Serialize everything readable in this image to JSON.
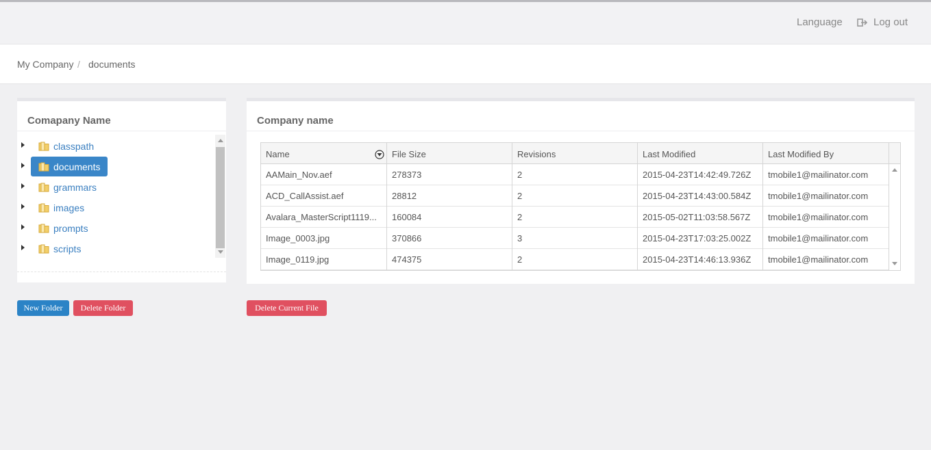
{
  "nav": {
    "language_label": "Language",
    "logout_label": "Log out"
  },
  "breadcrumb": {
    "home": "My Company",
    "separator": "/",
    "current": "documents"
  },
  "left_panel": {
    "title": "Comapany Name",
    "folders": [
      {
        "label": "classpath",
        "selected": false
      },
      {
        "label": "documents",
        "selected": true
      },
      {
        "label": "grammars",
        "selected": false
      },
      {
        "label": "images",
        "selected": false
      },
      {
        "label": "prompts",
        "selected": false
      },
      {
        "label": "scripts",
        "selected": false
      }
    ]
  },
  "right_panel": {
    "title": "Company name",
    "columns": [
      "Name",
      "File Size",
      "Revisions",
      "Last Modified",
      "Last Modified By"
    ],
    "rows": [
      [
        "AAMain_Nov.aef",
        "278373",
        "2",
        "2015-04-23T14:42:49.726Z",
        "tmobile1@mailinator.com"
      ],
      [
        "ACD_CallAssist.aef",
        "28812",
        "2",
        "2015-04-23T14:43:00.584Z",
        "tmobile1@mailinator.com"
      ],
      [
        "Avalara_MasterScript1119...",
        "160084",
        "2",
        "2015-05-02T11:03:58.567Z",
        "tmobile1@mailinator.com"
      ],
      [
        "Image_0003.jpg",
        "370866",
        "3",
        "2015-04-23T17:03:25.002Z",
        "tmobile1@mailinator.com"
      ],
      [
        "Image_0119.jpg",
        "474375",
        "2",
        "2015-04-23T14:46:13.936Z",
        "tmobile1@mailinator.com"
      ]
    ]
  },
  "buttons": {
    "new_folder": "New Folder",
    "delete_folder": "Delete Folder",
    "delete_current_file": "Delete Current File"
  },
  "colors": {
    "primary": "#2b83c6",
    "danger": "#e05060",
    "link": "#3a7fc0"
  }
}
